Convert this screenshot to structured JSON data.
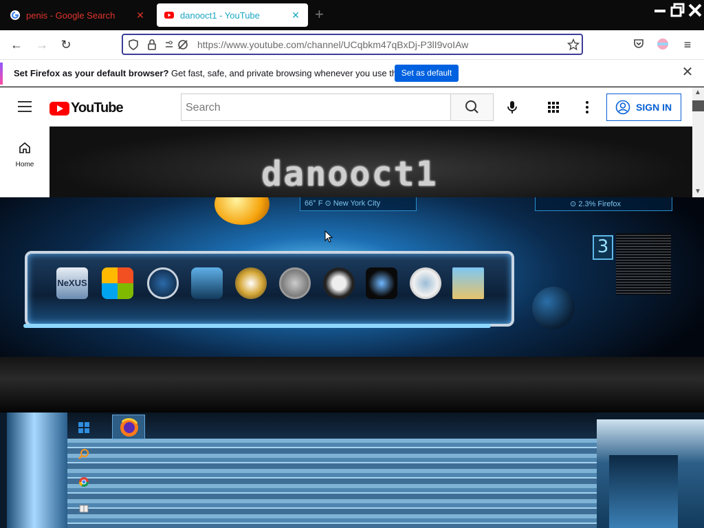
{
  "browser": {
    "tabs": [
      {
        "title": "penis - Google Search",
        "active": false
      },
      {
        "title": "danooct1 - YouTube",
        "active": true
      }
    ],
    "url": "https://www.youtube.com/channel/UCqbkm47qBxDj-P3lI9voIAw",
    "notification": {
      "bold": "Set Firefox as your default browser?",
      "text": " Get fast, safe, and private browsing whenever you use the web.",
      "button": "Set as default"
    }
  },
  "youtube": {
    "logo": "YouTube",
    "search_placeholder": "Search",
    "sign_in": "SIGN IN",
    "nav_home": "Home",
    "banner_text": "danooct1"
  },
  "desktop": {
    "weather": "66° F ⊙   New York City",
    "cpu": "⊙ 2.3% Firefox",
    "dock_labels": [
      "NeXUS"
    ],
    "note_icon": "3"
  },
  "colors": {
    "url_border": "#3b3c98",
    "default_btn": "#0061e0",
    "yt_red": "#ff0000",
    "sign_in_blue": "#065fd4"
  }
}
